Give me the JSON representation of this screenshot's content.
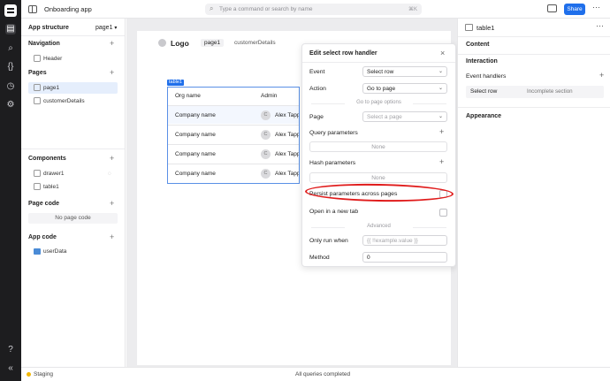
{
  "app": {
    "title": "Onboarding app"
  },
  "command": {
    "placeholder": "Type a command or search by name",
    "shortcut": "⌘K"
  },
  "topbar": {
    "share_label": "Share"
  },
  "left": {
    "app_structure": "App structure",
    "page_selector": "page1",
    "navigation": {
      "title": "Navigation",
      "items": [
        "Header"
      ]
    },
    "pages": {
      "title": "Pages",
      "items": [
        "page1",
        "customerDetails"
      ]
    },
    "components": {
      "title": "Components",
      "items": [
        "drawer1",
        "table1"
      ]
    },
    "page_code": {
      "title": "Page code",
      "empty": "No page code"
    },
    "app_code": {
      "title": "App code",
      "items": [
        "userData"
      ]
    }
  },
  "canvas": {
    "logo": "Logo",
    "nav": [
      "page1",
      "customerDetails"
    ],
    "table_badge": "table1",
    "table": {
      "columns": [
        "Org name",
        "Admin"
      ],
      "rows": [
        [
          "Company name",
          "Alex Tapp"
        ],
        [
          "Company name",
          "Alex Tapp"
        ],
        [
          "Company name",
          "Alex Tapp"
        ],
        [
          "Company name",
          "Alex Tapp"
        ]
      ]
    }
  },
  "modal": {
    "title": "Edit select row handler",
    "event_label": "Event",
    "event_value": "Select row",
    "action_label": "Action",
    "action_value": "Go to page",
    "options_heading": "Go to page options",
    "page_label": "Page",
    "page_placeholder": "Select a page",
    "query_label": "Query parameters",
    "query_none": "None",
    "hash_label": "Hash parameters",
    "hash_none": "None",
    "persist_label": "Persist parameters across pages",
    "newtab_label": "Open in a new tab",
    "advanced_heading": "Advanced",
    "run_when_label": "Only run when",
    "run_when_placeholder": "{{ !!example.value }}",
    "method_label": "Method",
    "method_value": "0"
  },
  "right": {
    "component": "table1",
    "content": "Content",
    "interaction": "Interaction",
    "event_handlers": "Event handlers",
    "handler_event": "Select row",
    "handler_status": "Incomplete section",
    "appearance": "Appearance"
  },
  "status": {
    "env": "Staging",
    "message": "All queries completed"
  },
  "icons": [
    "menu-icon",
    "search-icon",
    "code-icon",
    "history-icon",
    "settings-icon",
    "help-icon",
    "collapse-icon",
    "preview-icon",
    "more-icon"
  ],
  "colors": {
    "accent": "#1f6feb",
    "annotation": "#e01b1b",
    "staging": "#f2b705"
  }
}
